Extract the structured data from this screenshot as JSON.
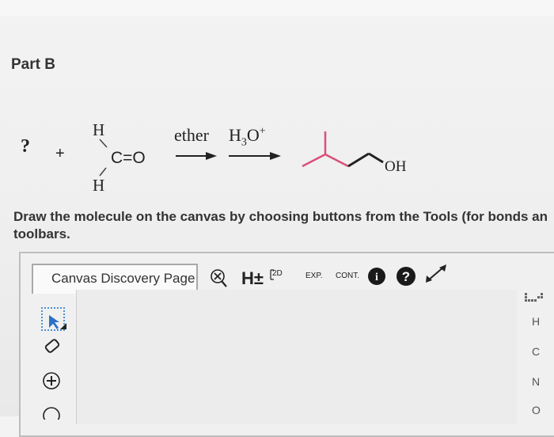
{
  "part": {
    "title": "Part B"
  },
  "reaction": {
    "unknown": "?",
    "plus": "+",
    "formaldehyde": {
      "top_h": "H",
      "carbonyl": "C=O",
      "bottom_h": "H"
    },
    "reagent_1": "ether",
    "reagent_2_base": "H",
    "reagent_2_sub": "3",
    "reagent_2_tail": "O",
    "reagent_2_sup": "+",
    "product_label": "OH"
  },
  "instructions": {
    "line1": "Draw the molecule on the canvas by choosing buttons from the Tools (for bonds an",
    "line2": "toolbars."
  },
  "toolbar": {
    "tab_label": "Canvas Discovery Page",
    "h_toggle": "H±",
    "two_d": "2D",
    "exp": "EXP.",
    "cont": "CONT.",
    "info": "i",
    "help": "?"
  },
  "elements": [
    "H",
    "C",
    "N",
    "O"
  ]
}
